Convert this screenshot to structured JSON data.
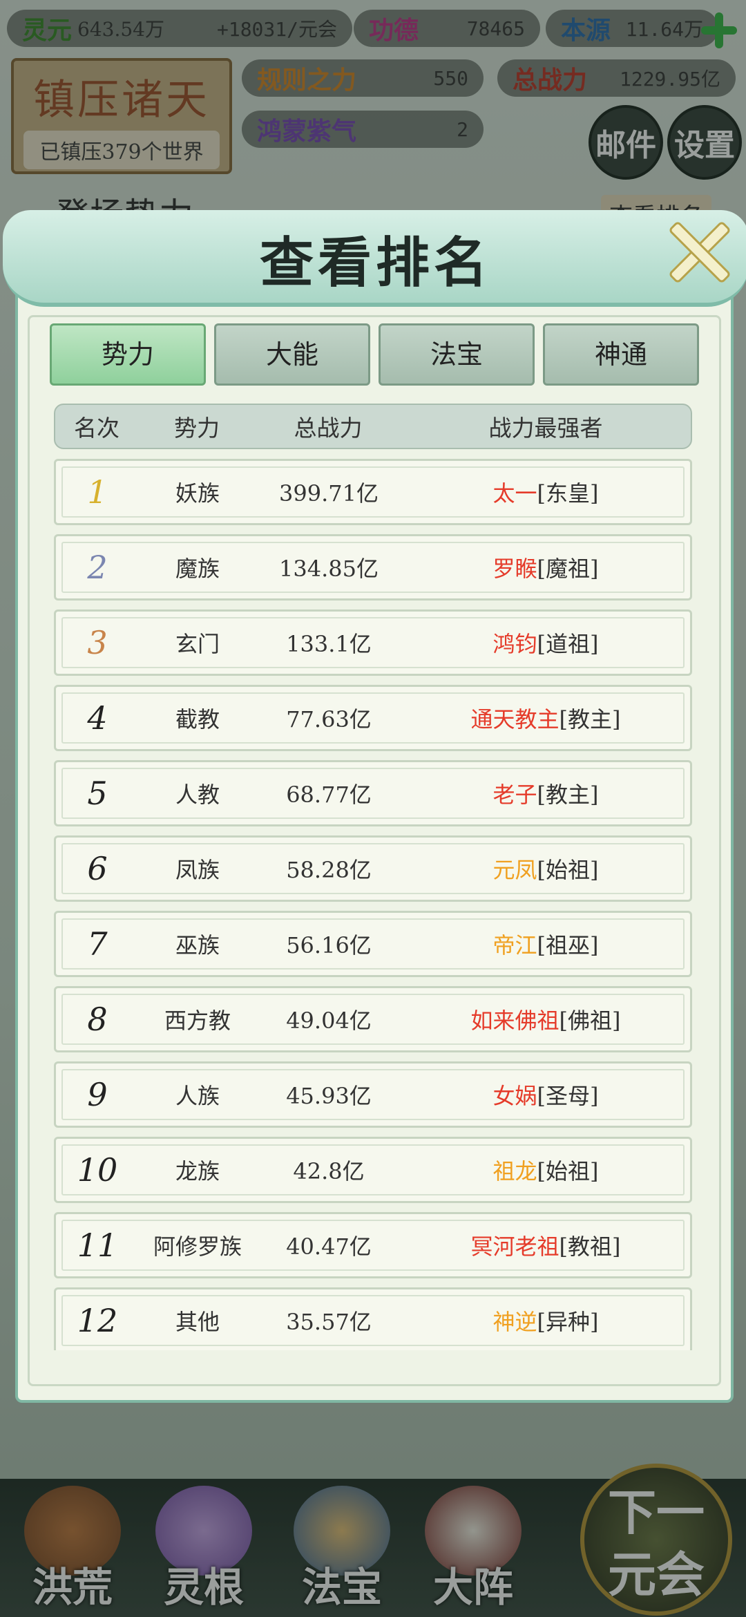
{
  "resources": {
    "lingyuan": {
      "label": "灵元",
      "value": "643.54万"
    },
    "rate": "+18031/元会",
    "gongde": {
      "label": "功德",
      "value": "78465"
    },
    "benyuan": {
      "label": "本源",
      "value": "11.64万"
    },
    "guize": {
      "label": "规则之力",
      "value": "550"
    },
    "zongzhanli": {
      "label": "总战力",
      "value": "1229.95亿"
    },
    "hongmeng": {
      "label": "鸿蒙紫气",
      "value": "2"
    }
  },
  "seal": {
    "title": "镇压诸天",
    "subtitle": "已镇压379个世界"
  },
  "buttons": {
    "mail": "邮件",
    "settings": "设置"
  },
  "behind": {
    "left": "登场势力",
    "right": "查看排名"
  },
  "modal": {
    "title": "查看排名",
    "tabs": [
      "势力",
      "大能",
      "法宝",
      "神通"
    ],
    "active_tab": "势力",
    "headers": [
      "名次",
      "势力",
      "总战力",
      "战力最强者"
    ],
    "rows": [
      {
        "rank": "1",
        "faction": "妖族",
        "power": "399.71亿",
        "leader": "太一",
        "title": "[东皇]",
        "color": "red"
      },
      {
        "rank": "2",
        "faction": "魔族",
        "power": "134.85亿",
        "leader": "罗睺",
        "title": "[魔祖]",
        "color": "red"
      },
      {
        "rank": "3",
        "faction": "玄门",
        "power": "133.1亿",
        "leader": "鸿钧",
        "title": "[道祖]",
        "color": "red"
      },
      {
        "rank": "4",
        "faction": "截教",
        "power": "77.63亿",
        "leader": "通天教主",
        "title": "[教主]",
        "color": "red"
      },
      {
        "rank": "5",
        "faction": "人教",
        "power": "68.77亿",
        "leader": "老子",
        "title": "[教主]",
        "color": "red"
      },
      {
        "rank": "6",
        "faction": "凤族",
        "power": "58.28亿",
        "leader": "元凤",
        "title": "[始祖]",
        "color": "orange"
      },
      {
        "rank": "7",
        "faction": "巫族",
        "power": "56.16亿",
        "leader": "帝江",
        "title": "[祖巫]",
        "color": "orange"
      },
      {
        "rank": "8",
        "faction": "西方教",
        "power": "49.04亿",
        "leader": "如来佛祖",
        "title": "[佛祖]",
        "color": "red"
      },
      {
        "rank": "9",
        "faction": "人族",
        "power": "45.93亿",
        "leader": "女娲",
        "title": "[圣母]",
        "color": "red"
      },
      {
        "rank": "10",
        "faction": "龙族",
        "power": "42.8亿",
        "leader": "祖龙",
        "title": "[始祖]",
        "color": "orange"
      },
      {
        "rank": "11",
        "faction": "阿修罗族",
        "power": "40.47亿",
        "leader": "冥河老祖",
        "title": "[教祖]",
        "color": "red"
      },
      {
        "rank": "12",
        "faction": "其他",
        "power": "35.57亿",
        "leader": "神逆",
        "title": "[异种]",
        "color": "orange"
      }
    ]
  },
  "nav": [
    "洪荒",
    "灵根",
    "法宝",
    "大阵"
  ],
  "next_button": {
    "line1": "下一",
    "line2": "元会"
  }
}
